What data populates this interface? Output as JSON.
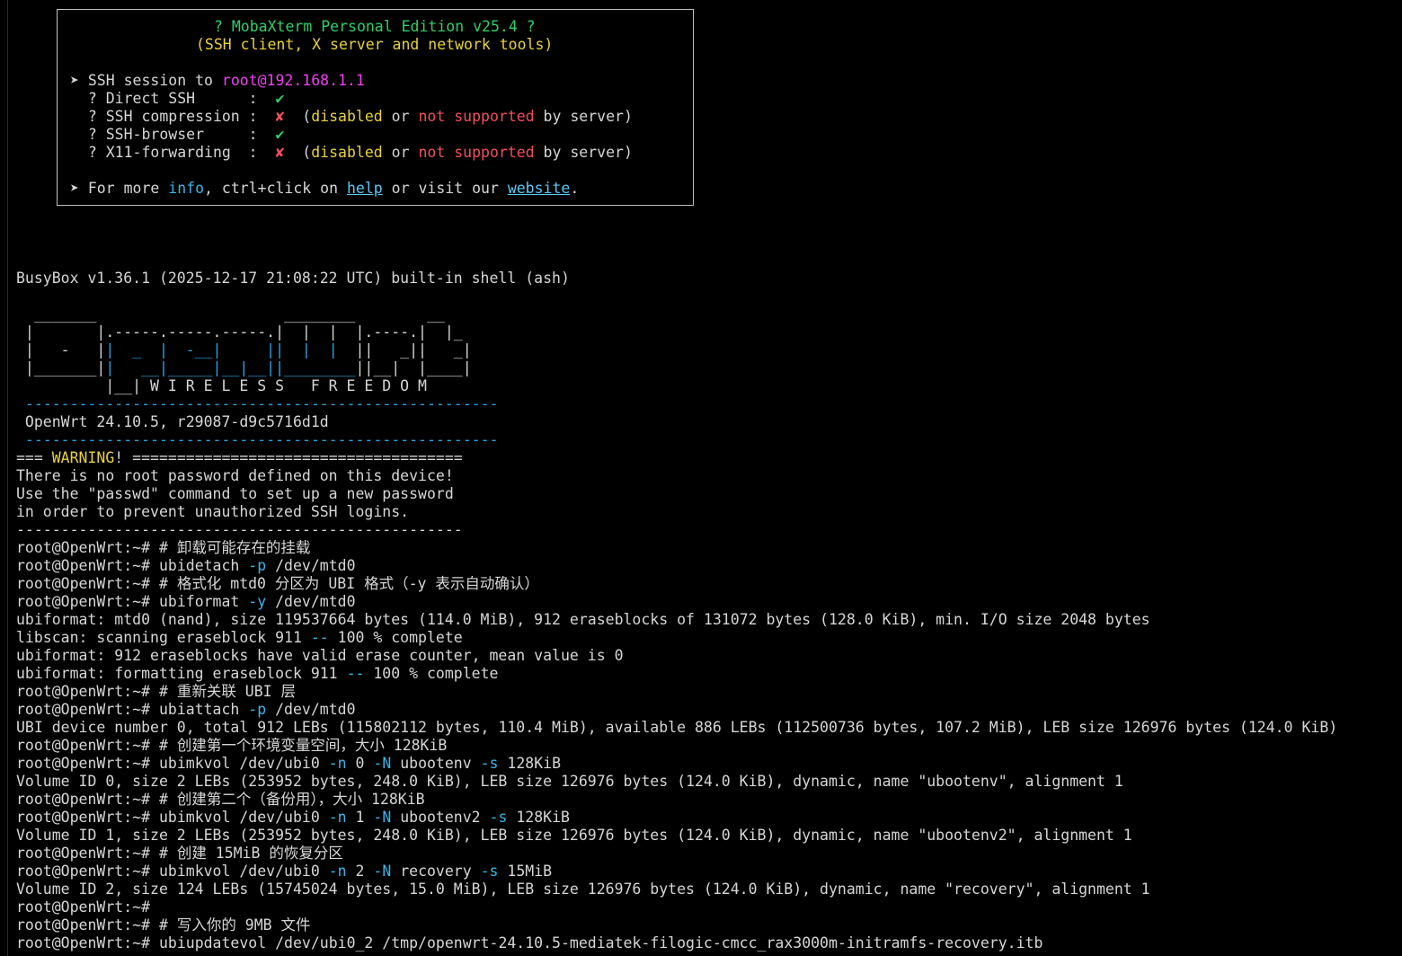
{
  "banner": {
    "title": "? MobaXterm Personal Edition v25.4 ?",
    "subtitle": "(SSH client, X server and network tools)",
    "session_prefix": "➤ SSH session to ",
    "session_host": "root@192.168.1.1",
    "features": [
      {
        "label": "  ? Direct SSH      :  ",
        "mark": "✔",
        "status": "ok"
      },
      {
        "label": "  ? SSH compression :  ",
        "mark": "✘",
        "status": "fail"
      },
      {
        "label": "  ? SSH-browser     :  ",
        "mark": "✔",
        "status": "ok"
      },
      {
        "label": "  ? X11-forwarding  :  ",
        "mark": "✘",
        "status": "fail"
      }
    ],
    "note_open": "  (",
    "note_disabled": "disabled",
    "note_or": " or ",
    "note_not": "not",
    "note_space": " ",
    "note_supported": "supported",
    "note_close": " by server)",
    "more_prefix": "➤ For more ",
    "more_info": "info",
    "more_mid": ", ctrl+click on ",
    "more_help": "help",
    "more_visit": " or visit our ",
    "more_website": "website",
    "more_end": "."
  },
  "busybox_line": "BusyBox v1.36.1 (2025-12-17 21:08:22 UTC) built-in shell (ash)",
  "ascii_logo": {
    "row1": "  _______                     ________        __",
    "row2a": " |       |.-----.-----.-----.|  |  |  |.----.|  |_",
    "row3a": " |   -   |",
    "row3b": "|  _  |  -__|     ",
    "row3c": "||  |  |  ",
    "row3d": "||   _||   _|",
    "row4a": " |_______|",
    "row4b": "|   __|_____|__|__|",
    "row4c": "|________",
    "row4d": "||__|  |____|",
    "row5": "          |__| W I R E L E S S   F R E E D O M",
    "dashes": " -----------------------------------------------------",
    "version": " OpenWrt 24.10.5, r29087-d9c5716d1d"
  },
  "warning": {
    "prefix": "=== ",
    "word": "WARNING",
    "suffix": "! =====================================",
    "line1": "There is no root password defined on this device!",
    "line2": "Use the \"passwd\" command to set up a new password",
    "line3": "in order to prevent unauthorized SSH logins.",
    "rule": "--------------------------------------------------"
  },
  "prompt": "root@OpenWrt:~# ",
  "session": [
    {
      "kind": "cmd",
      "parts": [
        {
          "t": "# 卸载可能存在的挂载"
        }
      ]
    },
    {
      "kind": "cmd",
      "parts": [
        {
          "t": "ubidetach "
        },
        {
          "t": "-p",
          "c": "cyan"
        },
        {
          "t": " /dev/mtd0"
        }
      ]
    },
    {
      "kind": "cmd",
      "parts": [
        {
          "t": "# 格式化 mtd0 分区为 UBI 格式（-y 表示自动确认）"
        }
      ]
    },
    {
      "kind": "cmd",
      "parts": [
        {
          "t": "ubiformat "
        },
        {
          "t": "-y",
          "c": "cyan"
        },
        {
          "t": " /dev/mtd0"
        }
      ]
    },
    {
      "kind": "out",
      "parts": [
        {
          "t": "ubiformat: mtd0 (nand), size 119537664 bytes (114.0 MiB), 912 eraseblocks of 131072 bytes (128.0 KiB), min. I/O size 2048 bytes"
        }
      ]
    },
    {
      "kind": "out",
      "parts": [
        {
          "t": "libscan: scanning eraseblock 911 "
        },
        {
          "t": "--",
          "c": "cyan"
        },
        {
          "t": " 100 % complete"
        }
      ]
    },
    {
      "kind": "out",
      "parts": [
        {
          "t": "ubiformat: 912 eraseblocks have valid erase counter, mean value is 0"
        }
      ]
    },
    {
      "kind": "out",
      "parts": [
        {
          "t": "ubiformat: formatting eraseblock 911 "
        },
        {
          "t": "--",
          "c": "cyan"
        },
        {
          "t": " 100 % complete"
        }
      ]
    },
    {
      "kind": "cmd",
      "parts": [
        {
          "t": "# 重新关联 UBI 层"
        }
      ]
    },
    {
      "kind": "cmd",
      "parts": [
        {
          "t": "ubiattach "
        },
        {
          "t": "-p",
          "c": "cyan"
        },
        {
          "t": " /dev/mtd0"
        }
      ]
    },
    {
      "kind": "out",
      "parts": [
        {
          "t": "UBI device number 0, total 912 LEBs (115802112 bytes, 110.4 MiB), available 886 LEBs (112500736 bytes, 107.2 MiB), LEB size 126976 bytes (124.0 KiB)"
        }
      ]
    },
    {
      "kind": "cmd",
      "parts": [
        {
          "t": "# 创建第一个环境变量空间，大小 128KiB"
        }
      ]
    },
    {
      "kind": "cmd",
      "parts": [
        {
          "t": "ubimkvol /dev/ubi0 "
        },
        {
          "t": "-n",
          "c": "cyan"
        },
        {
          "t": " 0 "
        },
        {
          "t": "-N",
          "c": "cyan"
        },
        {
          "t": " ubootenv "
        },
        {
          "t": "-s",
          "c": "cyan"
        },
        {
          "t": " 128KiB"
        }
      ]
    },
    {
      "kind": "out",
      "parts": [
        {
          "t": "Volume ID 0, size 2 LEBs (253952 bytes, 248.0 KiB), LEB size 126976 bytes (124.0 KiB), dynamic, name \"ubootenv\", alignment 1"
        }
      ]
    },
    {
      "kind": "cmd",
      "parts": [
        {
          "t": "# 创建第二个（备份用），大小 128KiB"
        }
      ]
    },
    {
      "kind": "cmd",
      "parts": [
        {
          "t": "ubimkvol /dev/ubi0 "
        },
        {
          "t": "-n",
          "c": "cyan"
        },
        {
          "t": " 1 "
        },
        {
          "t": "-N",
          "c": "cyan"
        },
        {
          "t": " ubootenv2 "
        },
        {
          "t": "-s",
          "c": "cyan"
        },
        {
          "t": " 128KiB"
        }
      ]
    },
    {
      "kind": "out",
      "parts": [
        {
          "t": "Volume ID 1, size 2 LEBs (253952 bytes, 248.0 KiB), LEB size 126976 bytes (124.0 KiB), dynamic, name \"ubootenv2\", alignment 1"
        }
      ]
    },
    {
      "kind": "cmd",
      "parts": [
        {
          "t": "# 创建 15MiB 的恢复分区"
        }
      ]
    },
    {
      "kind": "cmd",
      "parts": [
        {
          "t": "ubimkvol /dev/ubi0 "
        },
        {
          "t": "-n",
          "c": "cyan"
        },
        {
          "t": " 2 "
        },
        {
          "t": "-N",
          "c": "cyan"
        },
        {
          "t": " recovery "
        },
        {
          "t": "-s",
          "c": "cyan"
        },
        {
          "t": " 15MiB"
        }
      ]
    },
    {
      "kind": "out",
      "parts": [
        {
          "t": "Volume ID 2, size 124 LEBs (15745024 bytes, 15.0 MiB), LEB size 126976 bytes (124.0 KiB), dynamic, name \"recovery\", alignment 1"
        }
      ]
    },
    {
      "kind": "cmd",
      "parts": [
        {
          "t": ""
        }
      ]
    },
    {
      "kind": "cmd",
      "parts": [
        {
          "t": "# 写入你的 9MB 文件"
        }
      ]
    },
    {
      "kind": "cmd",
      "parts": [
        {
          "t": "ubiupdatevol /dev/ubi0_2 /tmp/openwrt-24.10.5-mediatek-filogic-cmcc_rax3000m-initramfs-recovery.itb"
        }
      ]
    }
  ],
  "colors": {
    "background": "#000000",
    "text": "#d6d6d6",
    "green": "#2fd06a",
    "yellow": "#e8d23a",
    "magenta": "#f040f0",
    "red": "#f0505a",
    "cyan": "#35b7ea",
    "link": "#5bc8f5"
  }
}
